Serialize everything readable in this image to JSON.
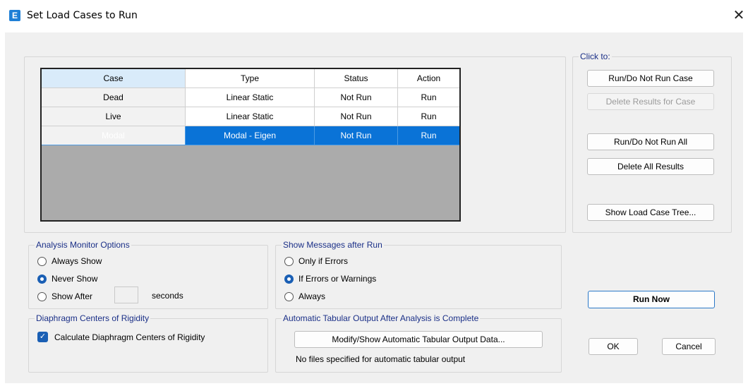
{
  "window": {
    "title": "Set Load Cases to Run",
    "app_icon_letter": "E",
    "close_glyph": "✕"
  },
  "table": {
    "headers": [
      "Case",
      "Type",
      "Status",
      "Action"
    ],
    "rows": [
      {
        "case": "Dead",
        "type": "Linear Static",
        "status": "Not Run",
        "action": "Run",
        "selected": false
      },
      {
        "case": "Live",
        "type": "Linear Static",
        "status": "Not Run",
        "action": "Run",
        "selected": false
      },
      {
        "case": "Modal",
        "type": "Modal - Eigen",
        "status": "Not Run",
        "action": "Run",
        "selected": true
      }
    ]
  },
  "click_to": {
    "label": "Click to:",
    "run_do_not_run_case": "Run/Do Not Run Case",
    "delete_results_for_case": "Delete Results for Case",
    "run_do_not_run_all": "Run/Do Not Run All",
    "delete_all_results": "Delete All Results",
    "show_load_case_tree": "Show Load Case Tree..."
  },
  "analysis_monitor": {
    "label": "Analysis Monitor Options",
    "always_show": "Always Show",
    "never_show": "Never Show",
    "show_after": "Show After",
    "seconds": "seconds",
    "show_after_value": "",
    "selected": "never_show"
  },
  "show_messages": {
    "label": "Show Messages after Run",
    "only_if_errors": "Only if Errors",
    "if_errors_or_warnings": "If Errors or Warnings",
    "always": "Always",
    "selected": "if_errors_or_warnings"
  },
  "diaphragm": {
    "label": "Diaphragm Centers of Rigidity",
    "calculate": "Calculate Diaphragm Centers of Rigidity",
    "checked": true
  },
  "auto_tabular": {
    "label": "Automatic Tabular Output After Analysis is Complete",
    "modify_button": "Modify/Show Automatic Tabular Output Data...",
    "status_text": "No files specified for automatic tabular output"
  },
  "actions": {
    "run_now": "Run Now",
    "ok": "OK",
    "cancel": "Cancel"
  },
  "colors": {
    "selection": "#0a73d7",
    "group_label": "#1a2f87",
    "accent": "#1a5fb4"
  }
}
